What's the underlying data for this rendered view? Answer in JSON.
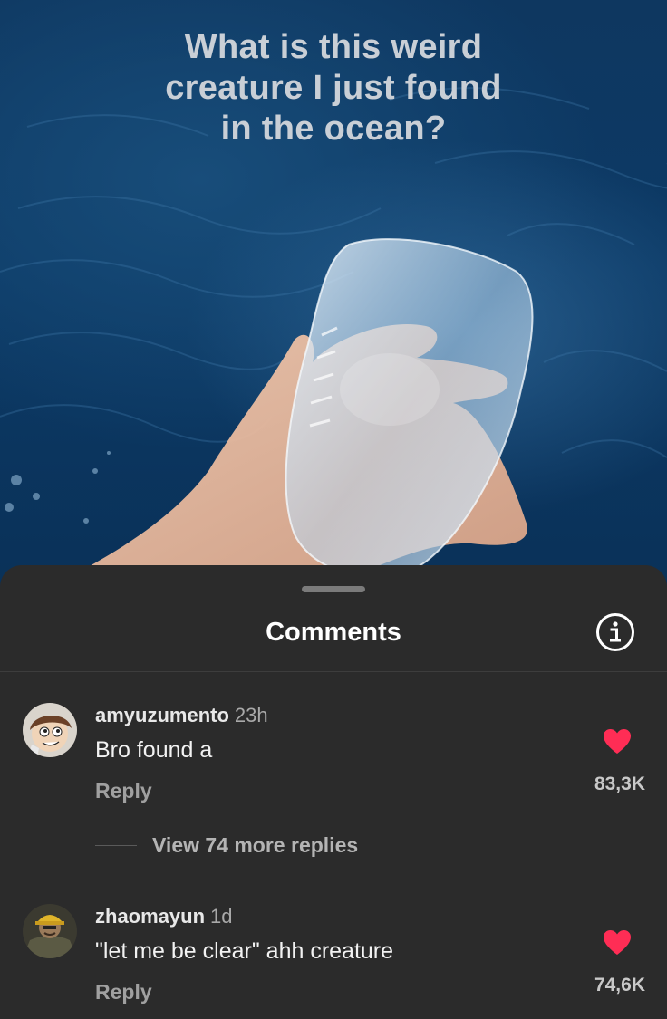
{
  "video": {
    "caption": "What is this weird\ncreature I just found\nin the ocean?"
  },
  "comments_sheet": {
    "title": "Comments",
    "info_icon": "info-icon",
    "comments": [
      {
        "username": "amyuzumento",
        "time": "23h",
        "text": "Bro found a",
        "reply_label": "Reply",
        "likes": "83,3K",
        "view_more_label": "View 74 more replies"
      },
      {
        "username": "zhaomayun",
        "time": "1d",
        "text": "\"let me be clear\" ahh creature",
        "reply_label": "Reply",
        "likes": "74,6K"
      }
    ]
  },
  "colors": {
    "sheet_background": "#2b2b2b",
    "heart": "#ff2d55",
    "ocean": "#0c3a66"
  }
}
